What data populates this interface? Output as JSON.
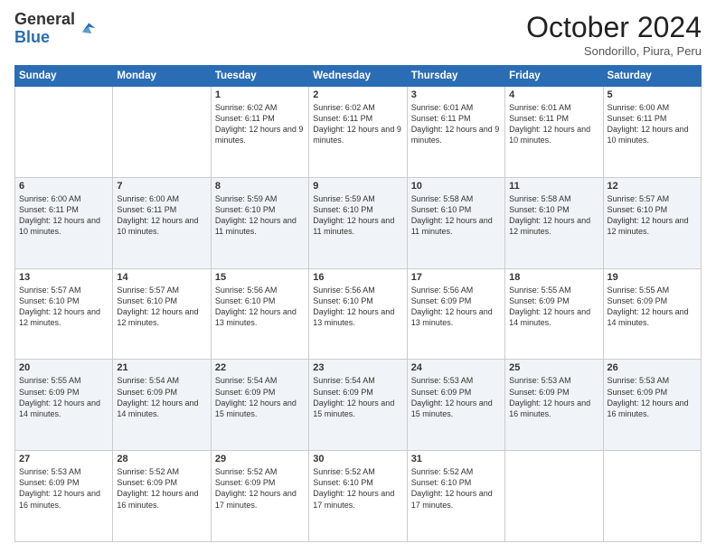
{
  "header": {
    "logo_line1": "General",
    "logo_line2": "Blue",
    "month": "October 2024",
    "location": "Sondorillo, Piura, Peru"
  },
  "weekdays": [
    "Sunday",
    "Monday",
    "Tuesday",
    "Wednesday",
    "Thursday",
    "Friday",
    "Saturday"
  ],
  "weeks": [
    [
      {
        "day": "",
        "info": ""
      },
      {
        "day": "",
        "info": ""
      },
      {
        "day": "1",
        "info": "Sunrise: 6:02 AM\nSunset: 6:11 PM\nDaylight: 12 hours and 9 minutes."
      },
      {
        "day": "2",
        "info": "Sunrise: 6:02 AM\nSunset: 6:11 PM\nDaylight: 12 hours and 9 minutes."
      },
      {
        "day": "3",
        "info": "Sunrise: 6:01 AM\nSunset: 6:11 PM\nDaylight: 12 hours and 9 minutes."
      },
      {
        "day": "4",
        "info": "Sunrise: 6:01 AM\nSunset: 6:11 PM\nDaylight: 12 hours and 10 minutes."
      },
      {
        "day": "5",
        "info": "Sunrise: 6:00 AM\nSunset: 6:11 PM\nDaylight: 12 hours and 10 minutes."
      }
    ],
    [
      {
        "day": "6",
        "info": "Sunrise: 6:00 AM\nSunset: 6:11 PM\nDaylight: 12 hours and 10 minutes."
      },
      {
        "day": "7",
        "info": "Sunrise: 6:00 AM\nSunset: 6:11 PM\nDaylight: 12 hours and 10 minutes."
      },
      {
        "day": "8",
        "info": "Sunrise: 5:59 AM\nSunset: 6:10 PM\nDaylight: 12 hours and 11 minutes."
      },
      {
        "day": "9",
        "info": "Sunrise: 5:59 AM\nSunset: 6:10 PM\nDaylight: 12 hours and 11 minutes."
      },
      {
        "day": "10",
        "info": "Sunrise: 5:58 AM\nSunset: 6:10 PM\nDaylight: 12 hours and 11 minutes."
      },
      {
        "day": "11",
        "info": "Sunrise: 5:58 AM\nSunset: 6:10 PM\nDaylight: 12 hours and 12 minutes."
      },
      {
        "day": "12",
        "info": "Sunrise: 5:57 AM\nSunset: 6:10 PM\nDaylight: 12 hours and 12 minutes."
      }
    ],
    [
      {
        "day": "13",
        "info": "Sunrise: 5:57 AM\nSunset: 6:10 PM\nDaylight: 12 hours and 12 minutes."
      },
      {
        "day": "14",
        "info": "Sunrise: 5:57 AM\nSunset: 6:10 PM\nDaylight: 12 hours and 12 minutes."
      },
      {
        "day": "15",
        "info": "Sunrise: 5:56 AM\nSunset: 6:10 PM\nDaylight: 12 hours and 13 minutes."
      },
      {
        "day": "16",
        "info": "Sunrise: 5:56 AM\nSunset: 6:10 PM\nDaylight: 12 hours and 13 minutes."
      },
      {
        "day": "17",
        "info": "Sunrise: 5:56 AM\nSunset: 6:09 PM\nDaylight: 12 hours and 13 minutes."
      },
      {
        "day": "18",
        "info": "Sunrise: 5:55 AM\nSunset: 6:09 PM\nDaylight: 12 hours and 14 minutes."
      },
      {
        "day": "19",
        "info": "Sunrise: 5:55 AM\nSunset: 6:09 PM\nDaylight: 12 hours and 14 minutes."
      }
    ],
    [
      {
        "day": "20",
        "info": "Sunrise: 5:55 AM\nSunset: 6:09 PM\nDaylight: 12 hours and 14 minutes."
      },
      {
        "day": "21",
        "info": "Sunrise: 5:54 AM\nSunset: 6:09 PM\nDaylight: 12 hours and 14 minutes."
      },
      {
        "day": "22",
        "info": "Sunrise: 5:54 AM\nSunset: 6:09 PM\nDaylight: 12 hours and 15 minutes."
      },
      {
        "day": "23",
        "info": "Sunrise: 5:54 AM\nSunset: 6:09 PM\nDaylight: 12 hours and 15 minutes."
      },
      {
        "day": "24",
        "info": "Sunrise: 5:53 AM\nSunset: 6:09 PM\nDaylight: 12 hours and 15 minutes."
      },
      {
        "day": "25",
        "info": "Sunrise: 5:53 AM\nSunset: 6:09 PM\nDaylight: 12 hours and 16 minutes."
      },
      {
        "day": "26",
        "info": "Sunrise: 5:53 AM\nSunset: 6:09 PM\nDaylight: 12 hours and 16 minutes."
      }
    ],
    [
      {
        "day": "27",
        "info": "Sunrise: 5:53 AM\nSunset: 6:09 PM\nDaylight: 12 hours and 16 minutes."
      },
      {
        "day": "28",
        "info": "Sunrise: 5:52 AM\nSunset: 6:09 PM\nDaylight: 12 hours and 16 minutes."
      },
      {
        "day": "29",
        "info": "Sunrise: 5:52 AM\nSunset: 6:09 PM\nDaylight: 12 hours and 17 minutes."
      },
      {
        "day": "30",
        "info": "Sunrise: 5:52 AM\nSunset: 6:10 PM\nDaylight: 12 hours and 17 minutes."
      },
      {
        "day": "31",
        "info": "Sunrise: 5:52 AM\nSunset: 6:10 PM\nDaylight: 12 hours and 17 minutes."
      },
      {
        "day": "",
        "info": ""
      },
      {
        "day": "",
        "info": ""
      }
    ]
  ]
}
